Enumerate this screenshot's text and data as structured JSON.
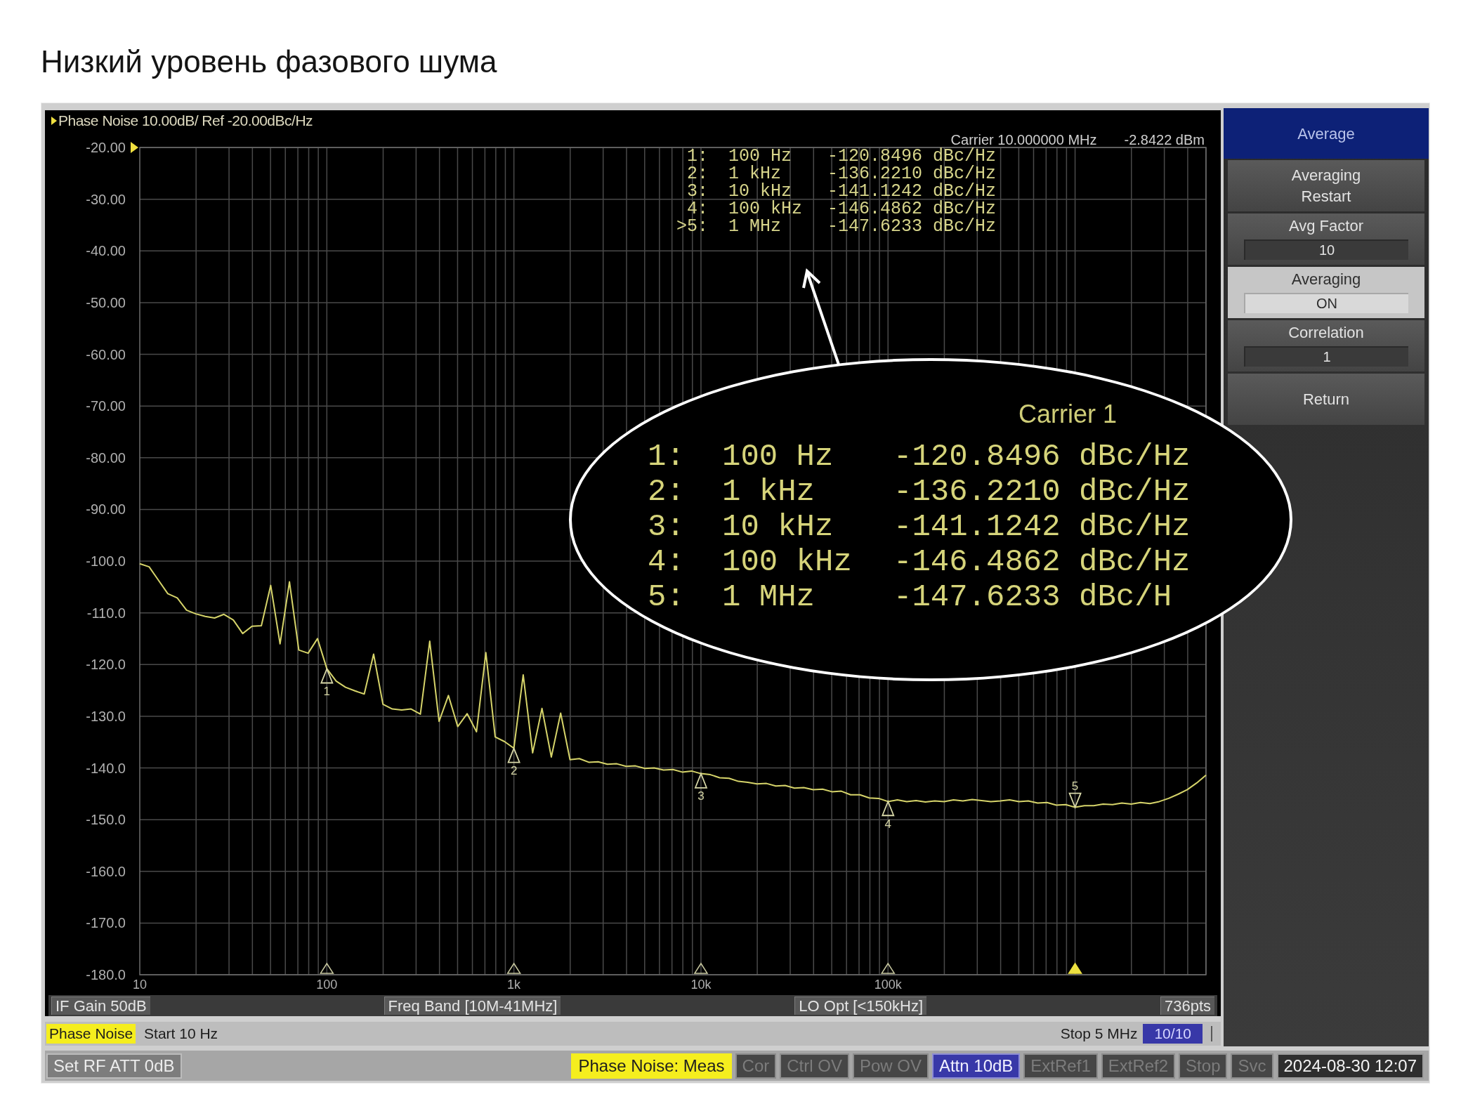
{
  "heading": "Низкий уровень фазового шума",
  "analyzer": {
    "carrier": {
      "frequency": "Carrier 10.000000 MHz",
      "power": "-2.8422 dBm"
    },
    "marker_table": [
      {
        "index": "1:",
        "frequency": "100 Hz",
        "value": "-120.8496 dBc/Hz",
        "selected": false
      },
      {
        "index": "2:",
        "frequency": "1 kHz",
        "value": "-136.2210 dBc/Hz",
        "selected": false
      },
      {
        "index": "3:",
        "frequency": "10 kHz",
        "value": "-141.1242 dBc/Hz",
        "selected": false
      },
      {
        "index": "4:",
        "frequency": "100 kHz",
        "value": "-146.4862 dBc/Hz",
        "selected": false
      },
      {
        "index": ">5:",
        "frequency": "1 MHz",
        "value": "-147.6233 dBc/Hz",
        "selected": true
      }
    ],
    "chart_data": {
      "type": "line",
      "title": "Phase Noise 10.00dB/ Ref -20.00dBc/Hz",
      "grid": true,
      "categories": [
        "10",
        null,
        null,
        null,
        null,
        null,
        null,
        null,
        null,
        null,
        null,
        null,
        null,
        null,
        null,
        null,
        null,
        null,
        null,
        null,
        "100",
        null,
        null,
        null,
        null,
        null,
        null,
        null,
        null,
        null,
        null,
        null,
        null,
        null,
        null,
        null,
        null,
        null,
        null,
        null,
        "1k",
        null,
        null,
        null,
        null,
        null,
        null,
        null,
        null,
        null,
        null,
        null,
        null,
        null,
        null,
        null,
        null,
        null,
        null,
        null,
        "10k",
        null,
        null,
        null,
        null,
        null,
        null,
        null,
        null,
        null,
        null,
        null,
        null,
        null,
        null,
        null,
        null,
        null,
        null,
        null,
        "100k",
        null,
        null,
        null,
        null,
        null,
        null,
        null,
        null,
        null,
        null,
        null,
        null,
        null,
        null,
        null,
        null,
        null,
        null,
        null,
        null,
        null,
        null,
        null,
        null,
        null,
        null,
        null,
        null,
        null,
        null,
        null,
        null,
        null,
        null
      ],
      "series": [
        {
          "color": "#d6d46a",
          "values": [
            -100.5,
            -101.1,
            -103.7,
            -106.3,
            -107.1,
            -109.5,
            -110.2,
            -110.7,
            -111,
            -110.3,
            -111.4,
            -114,
            -112.6,
            -112.5,
            -104.7,
            -116,
            -104,
            -117.2,
            -117.8,
            -115,
            -120.8,
            -123.2,
            -124.4,
            -125.1,
            -125.7,
            -118,
            -127.7,
            -128.6,
            -128.8,
            -128.6,
            -129.6,
            -115.5,
            -131,
            -126,
            -132,
            -129.5,
            -133,
            -117.7,
            -134,
            -134.9,
            -136.2,
            -122,
            -137.1,
            -128.5,
            -137.9,
            -129.4,
            -138.4,
            -138.2,
            -138.9,
            -138.8,
            -139.3,
            -139.2,
            -139.7,
            -139.6,
            -140.1,
            -140,
            -140.4,
            -140.3,
            -140.8,
            -140.6,
            -141.1,
            -141.3,
            -141.9,
            -142,
            -142.6,
            -142.8,
            -143.1,
            -143,
            -143.5,
            -143.4,
            -143.9,
            -143.8,
            -144.2,
            -144.1,
            -144.6,
            -144.5,
            -145.2,
            -145.2,
            -145.8,
            -145.9,
            -146.5,
            -146.2,
            -146.5,
            -146.3,
            -146.6,
            -146.4,
            -146.5,
            -146.2,
            -146.4,
            -146.1,
            -146.3,
            -146.5,
            -146.4,
            -146.2,
            -146.5,
            -146.4,
            -146.8,
            -146.7,
            -147.2,
            -147.1,
            -147.6,
            -147.3,
            -147.3,
            -147,
            -147.1,
            -146.8,
            -147,
            -146.7,
            -146.9,
            -146.5,
            -145.9,
            -145.1,
            -144.2,
            -142.9,
            -141.4
          ]
        }
      ],
      "ylim": [
        -180,
        -20
      ],
      "yticks": [
        {
          "value": -20,
          "label": "-20.00"
        },
        {
          "value": -30,
          "label": "-30.00"
        },
        {
          "value": -40,
          "label": "-40.00"
        },
        {
          "value": -50,
          "label": "-50.00"
        },
        {
          "value": -60,
          "label": "-60.00"
        },
        {
          "value": -70,
          "label": "-70.00"
        },
        {
          "value": -80,
          "label": "-80.00"
        },
        {
          "value": -90,
          "label": "-90.00"
        },
        {
          "value": -100,
          "label": "-100.0"
        },
        {
          "value": -110,
          "label": "-110.0"
        },
        {
          "value": -120,
          "label": "-120.0"
        },
        {
          "value": -130,
          "label": "-130.0"
        },
        {
          "value": -140,
          "label": "-140.0"
        },
        {
          "value": -150,
          "label": "-150.0"
        },
        {
          "value": -160,
          "label": "-160.0"
        },
        {
          "value": -170,
          "label": "-170.0"
        },
        {
          "value": -180,
          "label": "-180.0"
        }
      ],
      "annotations": [
        {
          "x": "100",
          "y": -120.8496,
          "text": "1"
        },
        {
          "x": "1k",
          "y": -136.221,
          "text": "2"
        },
        {
          "x": "10k",
          "y": -141.1242,
          "text": "3"
        },
        {
          "x": "100k",
          "y": -146.4862,
          "text": "4"
        },
        {
          "y": -147.6233,
          "text": "5"
        }
      ]
    },
    "callout": {
      "carrier": "Carrier 1",
      "rows": [
        {
          "index": "1:",
          "frequency": "100 Hz",
          "value": "-120.8496 dBc/Hz"
        },
        {
          "index": "2:",
          "frequency": "1 kHz",
          "value": "-136.2210 dBc/Hz"
        },
        {
          "index": "3:",
          "frequency": "10 kHz",
          "value": "-141.1242 dBc/Hz"
        },
        {
          "index": "4:",
          "frequency": "100 kHz",
          "value": "-146.4862 dBc/Hz"
        },
        {
          "index": "5:",
          "frequency": "1 MHz",
          "value": "-147.6233 dBc/H"
        }
      ]
    },
    "info_bar": [
      "IF Gain 50dB",
      "Freq Band [10M-41MHz]",
      "LO Opt [<150kHz]",
      "736pts"
    ],
    "sweep_bar": {
      "mode": "Phase Noise",
      "start": "Start 10 Hz",
      "stop": "Stop 5 MHz",
      "count": "10/10"
    },
    "status_bar": {
      "message": "Set RF ATT 0dB",
      "indicators": [
        {
          "text": "Phase Noise: Meas",
          "kind": "measure"
        },
        {
          "text": "Cor",
          "kind": "off"
        },
        {
          "text": "Ctrl OV",
          "kind": "off"
        },
        {
          "text": "Pow OV",
          "kind": "off"
        },
        {
          "text": "Attn 10dB",
          "kind": "on"
        },
        {
          "text": "ExtRef1",
          "kind": "off"
        },
        {
          "text": "ExtRef2",
          "kind": "off"
        },
        {
          "text": "Stop",
          "kind": "off"
        },
        {
          "text": "Svc",
          "kind": "off"
        },
        {
          "text": "2024-08-30 12:07",
          "kind": "clock"
        }
      ]
    }
  },
  "softkeys": {
    "title": "Average",
    "items": [
      {
        "kind": "action",
        "label": "Averaging Restart",
        "selected": false
      },
      {
        "kind": "value",
        "label": "Avg Factor",
        "value": "10",
        "selected": false
      },
      {
        "kind": "value",
        "label": "Averaging",
        "value": "ON",
        "selected": true
      },
      {
        "kind": "value",
        "label": "Correlation",
        "value": "1",
        "selected": false
      },
      {
        "kind": "action",
        "label": "Return",
        "selected": false
      }
    ]
  }
}
